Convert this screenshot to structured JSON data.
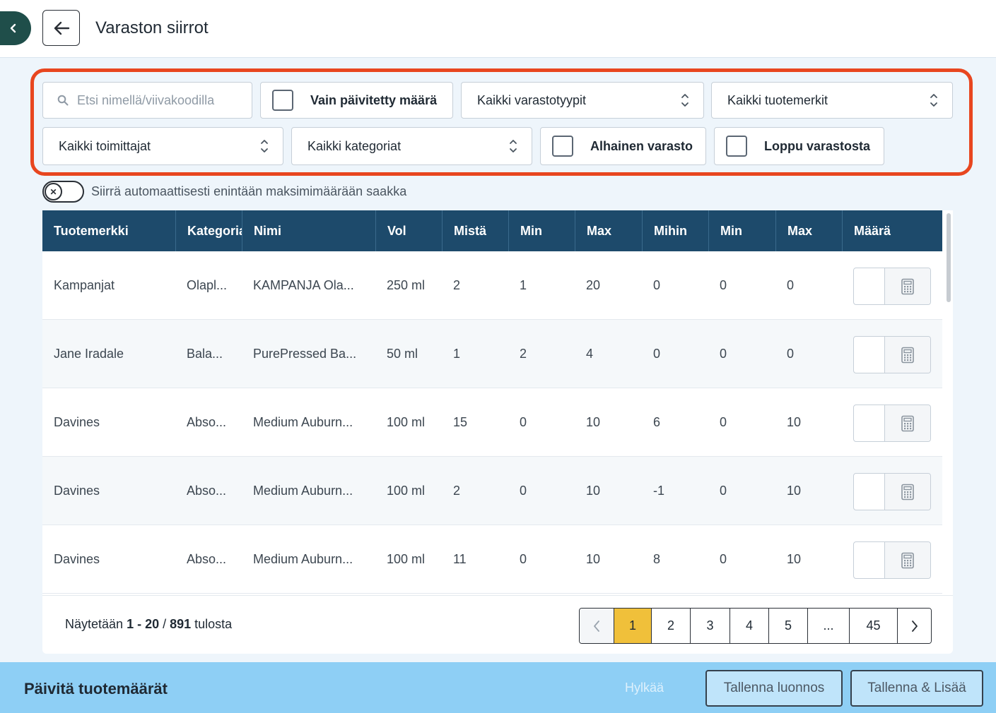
{
  "header": {
    "title": "Varaston siirrot",
    "sidebar_toggle_icon": "chevron-left-icon",
    "back_icon": "arrow-left-icon"
  },
  "filters": {
    "search_placeholder": "Etsi nimellä/viivakoodilla",
    "only_updated_label": "Vain päivitetty määrä",
    "warehouse_types": "Kaikki varastotyypit",
    "brands": "Kaikki tuotemerkit",
    "suppliers": "Kaikki toimittajat",
    "categories": "Kaikki kategoriat",
    "low_stock_label": "Alhainen varasto",
    "out_of_stock_label": "Loppu varastosta"
  },
  "auto_move": {
    "label": "Siirrä automaattisesti enintään maksimimäärään saakka",
    "enabled": false
  },
  "table": {
    "columns": [
      "Tuotemerkki",
      "Kategoria",
      "Nimi",
      "Vol",
      "Mistä",
      "Min",
      "Max",
      "Mihin",
      "Min",
      "Max",
      "Määrä"
    ],
    "rows": [
      [
        "Kampanjat",
        "Olapl...",
        "KAMPANJA Ola...",
        "250 ml",
        "2",
        "1",
        "20",
        "0",
        "0",
        "0"
      ],
      [
        "Jane Iradale",
        "Bala...",
        "PurePressed Ba...",
        "50 ml",
        "1",
        "2",
        "4",
        "0",
        "0",
        "0"
      ],
      [
        "Davines",
        "Abso...",
        "Medium Auburn...",
        "100 ml",
        "15",
        "0",
        "10",
        "6",
        "0",
        "10"
      ],
      [
        "Davines",
        "Abso...",
        "Medium Auburn...",
        "100 ml",
        "2",
        "0",
        "10",
        "-1",
        "0",
        "10"
      ],
      [
        "Davines",
        "Abso...",
        "Medium Auburn...",
        "100 ml",
        "11",
        "0",
        "10",
        "8",
        "0",
        "10"
      ]
    ]
  },
  "pagination": {
    "showing_prefix": "Näytetään ",
    "showing_range": "1 - 20",
    "showing_sep": " / ",
    "showing_total": "891",
    "showing_suffix": " tulosta",
    "pages": [
      "1",
      "2",
      "3",
      "4",
      "5",
      "...",
      "45"
    ],
    "current_page": "1"
  },
  "footer": {
    "title": "Päivitä tuotemäärät",
    "reject": "Hylkää",
    "save_draft": "Tallenna luonnos",
    "save_add": "Tallenna & Lisää"
  },
  "colors": {
    "header_bg": "#1d4a6b",
    "highlight_frame": "#e8461f",
    "active_page": "#f0c03a",
    "footer_bg": "#8ecff5"
  }
}
